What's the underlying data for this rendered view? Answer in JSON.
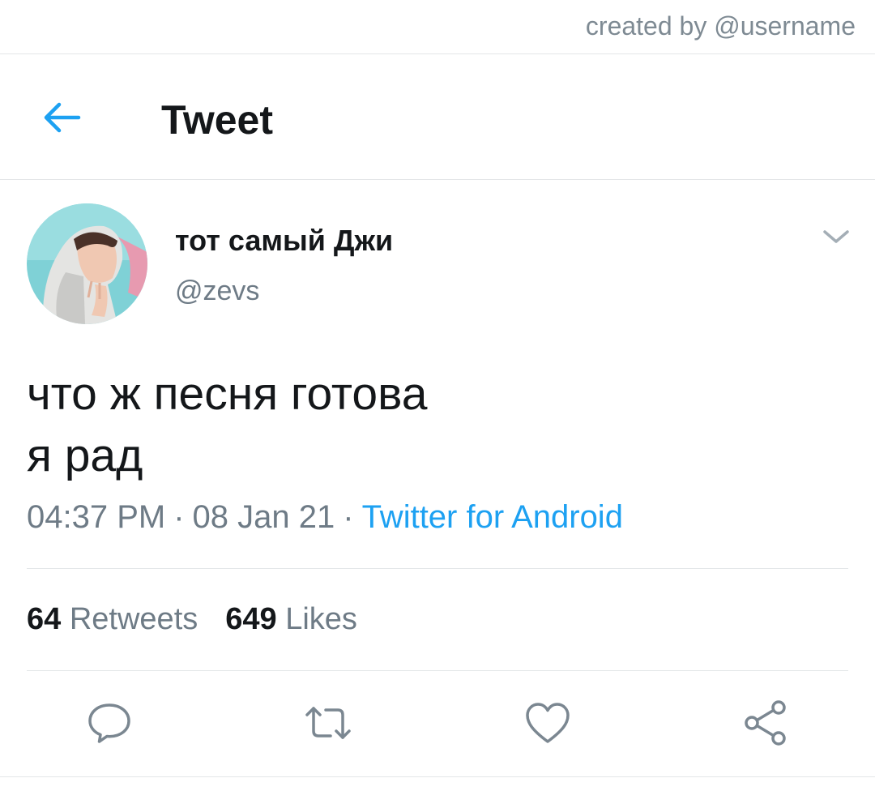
{
  "credit": "created by @username",
  "header": {
    "title": "Tweet",
    "back_icon": "arrow-left-icon"
  },
  "tweet": {
    "author": {
      "display_name": "тот самый Джи",
      "handle": "@zevs"
    },
    "text_lines": [
      "что ж песня готова",
      "я рад"
    ],
    "time": "04:37 PM",
    "date": "08 Jan 21",
    "separator": "·",
    "source": "Twitter for Android",
    "stats": {
      "retweets_count": "64",
      "retweets_label": "Retweets",
      "likes_count": "649",
      "likes_label": "Likes"
    }
  },
  "actions": [
    "reply-icon",
    "retweet-icon",
    "like-icon",
    "share-icon"
  ],
  "colors": {
    "accent": "#1da1f2",
    "text_primary": "#14171a",
    "text_secondary": "#6e7b86",
    "divider": "#e3e6e8",
    "icon_gray": "#7b8791"
  }
}
